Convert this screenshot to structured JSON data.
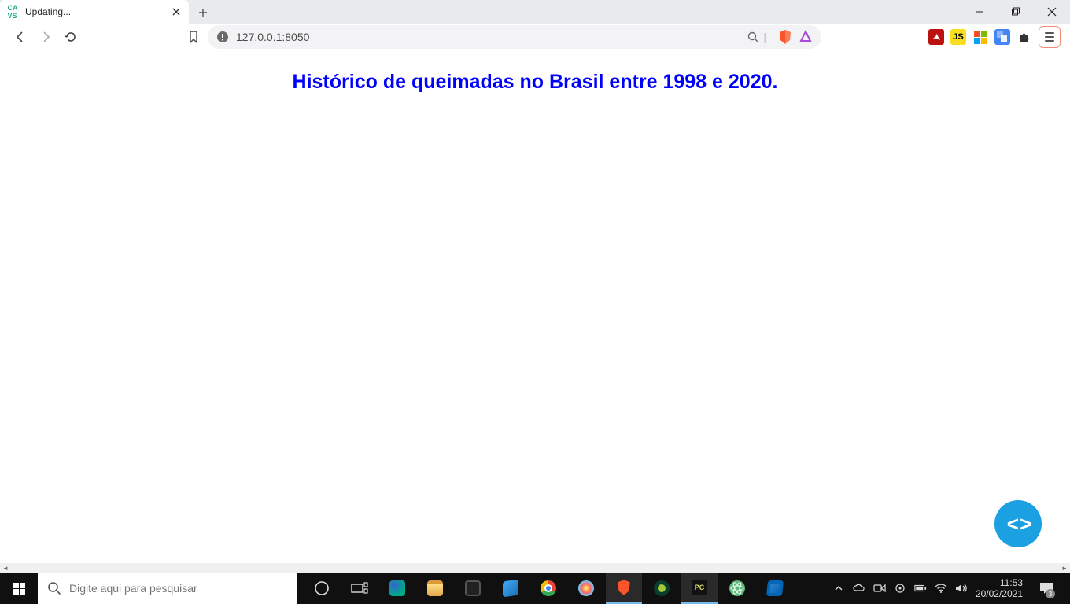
{
  "browser": {
    "tab": {
      "title": "Updating..."
    },
    "url": "127.0.0.1:8050"
  },
  "page": {
    "heading": "Histórico de queimadas no Brasil entre 1998 e 2020."
  },
  "taskbar": {
    "search_placeholder": "Digite aqui para pesquisar"
  },
  "tray": {
    "time": "11:53",
    "date": "20/02/2021",
    "notif_count": "3"
  }
}
